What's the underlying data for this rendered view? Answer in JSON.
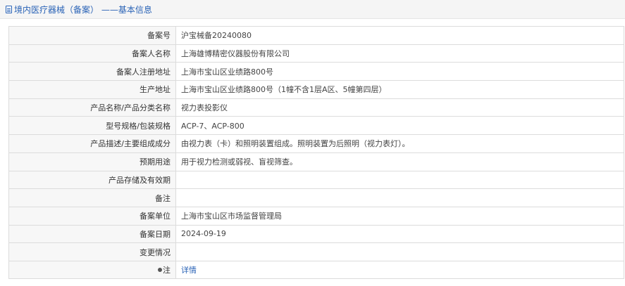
{
  "header": {
    "title": "境内医疗器械（备案） ——基本信息",
    "icon": "document-icon"
  },
  "rows": [
    {
      "label": "备案号",
      "value": "沪宝械备20240080"
    },
    {
      "label": "备案人名称",
      "value": "上海雄博精密仪器股份有限公司"
    },
    {
      "label": "备案人注册地址",
      "value": "上海市宝山区业绩路800号"
    },
    {
      "label": "生产地址",
      "value": "上海市宝山区业绩路800号（1幢不含1层A区、5幢第四层）"
    },
    {
      "label": "产品名称/产品分类名称",
      "value": "视力表投影仪"
    },
    {
      "label": "型号规格/包装规格",
      "value": "ACP-7、ACP-800"
    },
    {
      "label": "产品描述/主要组成成分",
      "value": "由视力表（卡）和照明装置组成。照明装置为后照明（视力表灯）。"
    },
    {
      "label": "预期用途",
      "value": "用于视力检测或弱视、盲视筛查。"
    },
    {
      "label": "产品存储及有效期",
      "value": ""
    },
    {
      "label": "备注",
      "value": ""
    },
    {
      "label": "备案单位",
      "value": "上海市宝山区市场监督管理局"
    },
    {
      "label": "备案日期",
      "value": "2024-09-19"
    },
    {
      "label": "变更情况",
      "value": ""
    }
  ],
  "note_row": {
    "label": "注",
    "link": "详情",
    "icon": "bullet-icon"
  }
}
